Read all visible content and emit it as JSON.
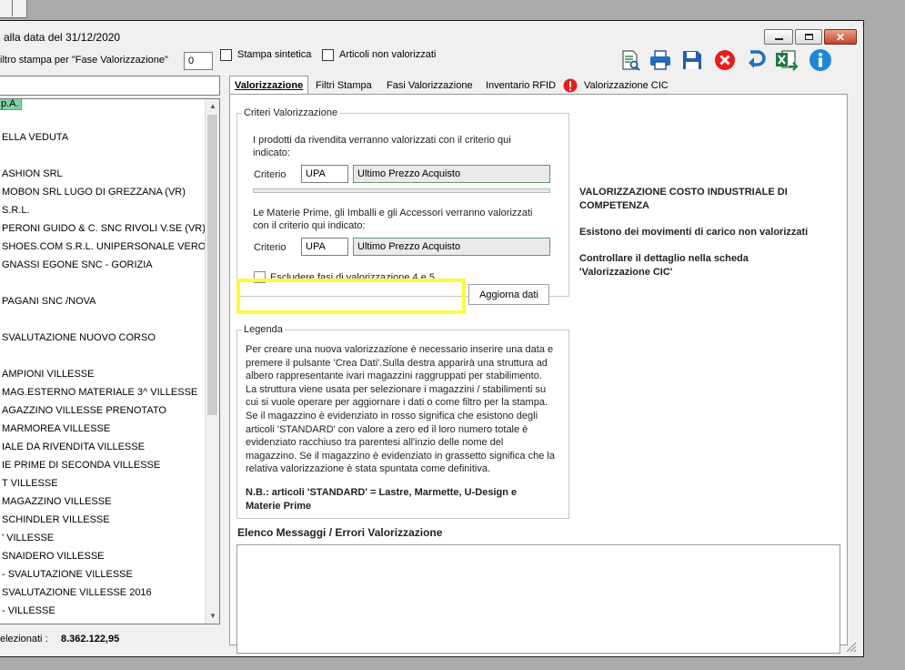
{
  "window": {
    "title": "alla data del 31/12/2020",
    "close_glyph": "✕"
  },
  "filters": {
    "fase_label": "iltro stampa per \"Fase Valorizzazione\"",
    "fase_value": "0",
    "stampa_sintetica_label": "Stampa sintetica",
    "articoli_non_valorizzati_label": "Articoli non valorizzati"
  },
  "tree_items": [
    "p.A.",
    "ELLA VEDUTA",
    "ASHION SRL",
    "MOBON SRL  LUGO DI GREZZANA (VR)",
    "S.R.L.",
    "PERONI GUIDO & C. SNC  RIVOLI V.SE (VR)",
    "SHOES.COM S.R.L.  UNIPERSONALE    VERO",
    "GNASSI EGONE SNC  - GORIZIA",
    "PAGANI SNC /NOVA",
    "SVALUTAZIONE NUOVO CORSO",
    "AMPIONI VILLESSE",
    "MAG.ESTERNO MATERIALE 3^ VILLESSE",
    "AGAZZINO VILLESSE PRENOTATO",
    "MARMOREA VILLESSE",
    "IALE DA RIVENDITA VILLESSE",
    "IE PRIME DI SECONDA VILLESSE",
    "T VILLESSE",
    "MAGAZZINO VILLESSE",
    "SCHINDLER VILLESSE",
    "' VILLESSE",
    "SNAIDERO VILLESSE",
    "- SVALUTAZIONE VILLESSE",
    "SVALUTAZIONE VILLESSE 2016",
    "- VILLESSE"
  ],
  "footer": {
    "selezionati_label": "elezionati :",
    "selezionati_value": "8.362.122,95"
  },
  "toolbar": {
    "icons": [
      "preview-icon",
      "print-icon",
      "save-icon",
      "cancel-icon",
      "undo-icon",
      "excel-export-icon",
      "info-icon"
    ]
  },
  "tabs": [
    {
      "label": "Valorizzazione",
      "active": true
    },
    {
      "label": "Filtri Stampa",
      "active": false
    },
    {
      "label": "Fasi Valorizzazione",
      "active": false
    },
    {
      "label": "Inventario RFID",
      "active": false
    },
    {
      "label": "Valorizzazione CIC",
      "active": false
    }
  ],
  "criteri": {
    "title": "Criteri Valorizzazione",
    "rivendita_text_1": "I prodotti da rivendita verranno valorizzati con il criterio qui",
    "rivendita_text_2": "indicato:",
    "criterio_label": "Criterio",
    "criterio1_code": "UPA",
    "criterio1_desc": "Ultimo Prezzo Acquisto",
    "materie_text_1": "Le Materie Prime, gli Imballi e gli Accessori verranno valorizzati",
    "materie_text_2": "con il criterio qui indicato:",
    "criterio2_code": "UPA",
    "criterio2_desc": "Ultimo Prezzo Acquisto",
    "escludere_label": "Escludere fasi di valorizzazione 4 e 5",
    "aggiorna_label": "Aggiorna dati"
  },
  "legenda": {
    "title": "Legenda",
    "lines": [
      "Per creare una nuova valorizzazione è necessario inserire una data e",
      "premere il pulsante 'Crea Dati'.Sulla destra apparirà una struttura ad",
      "albero rappresentante ivari magazzini raggruppati per stabilimento.",
      "La struttura viene usata per selezionare i magazzini / stabilimenti su",
      "cui si vuole operare per aggiornare i dati o come filtro per la stampa.",
      "Se il magazzino è evidenziato in rosso significa che esistono degli",
      "articoli 'STANDARD' con valore a zero ed il loro numero totale è",
      "evidenziato racchiuso tra parentesi all'inzio delle nome del",
      "magazzino. Se il magazzino è evidenziato in grassetto significa che la",
      "relativa valorizzazione è stata spuntata come definitiva."
    ],
    "nb_line_1": "N.B.: articoli 'STANDARD' = Lastre, Marmette, U-Design e",
    "nb_line_2": "Materie Prime"
  },
  "cic_info": {
    "line1": "VALORIZZAZIONE COSTO INDUSTRIALE DI",
    "line2": "COMPETENZA",
    "line3": "Esistono dei movimenti di carico non valorizzati",
    "line4": "Controllare il dettaglio nella scheda",
    "line5": "'Valorizzazione CIC'"
  },
  "messages": {
    "title": "Elenco  Messaggi / Errori Valorizzazione"
  },
  "colors": {
    "highlight": "#fff83d",
    "tree_selected": "#7fd4a4",
    "alert_red": "#e81c1c",
    "toolbar_blue": "#1f6fc0"
  }
}
